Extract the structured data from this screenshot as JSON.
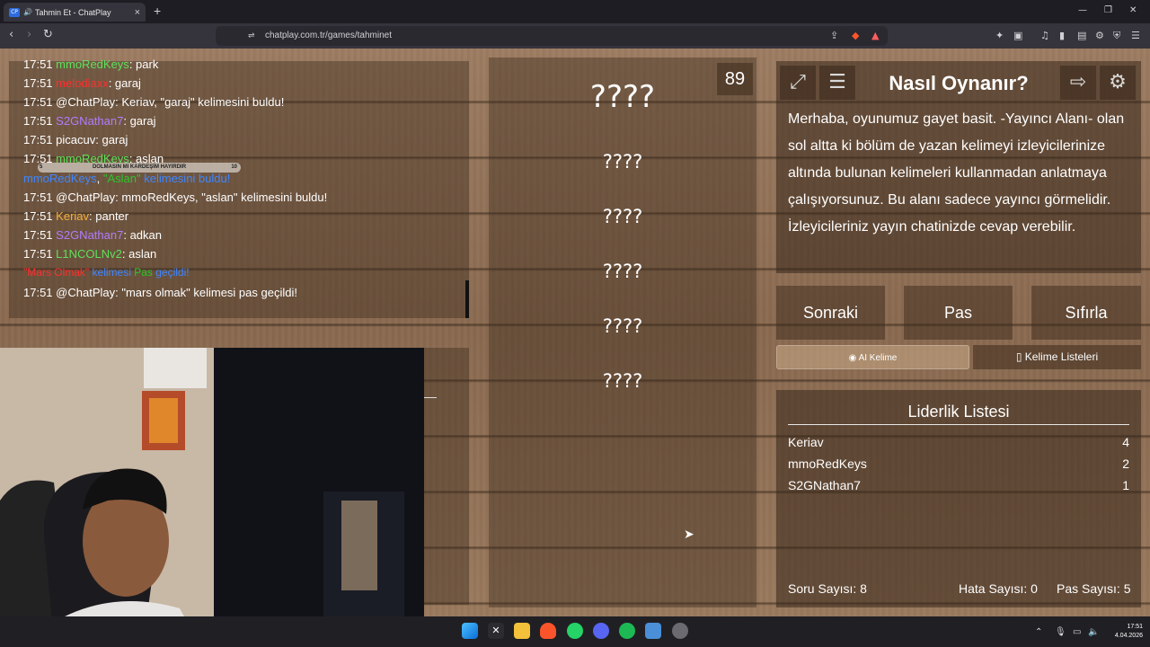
{
  "browser": {
    "tab_title": "Tahmin Et - ChatPlay",
    "tab_favicon": "CP",
    "url": "chatplay.com.tr/games/tahminet"
  },
  "chat": {
    "overlay": {
      "left": "5",
      "text": "DOLMASIN MI KARDEŞİM HAYIRDIR",
      "right": "10"
    },
    "lines": [
      {
        "time": "17:51",
        "user": "mmoRedKeys",
        "user_color": "green",
        "msg": ": park"
      },
      {
        "time": "17:51",
        "user": "melodiaxx",
        "user_color": "red",
        "msg": ": garaj"
      },
      {
        "time": "17:51",
        "user": "@ChatPlay",
        "user_color": "white",
        "msg": ": Keriav, \"garaj\" kelimesini buldu!"
      },
      {
        "time": "17:51",
        "user": "S2GNathan7",
        "user_color": "purple",
        "msg": ": garaj"
      },
      {
        "time": "17:51",
        "user": "picacuv",
        "user_color": "white",
        "msg": ": garaj"
      },
      {
        "time": "17:51",
        "user": "mmoRedKeys",
        "user_color": "green",
        "msg": ": aslan"
      }
    ],
    "system_line_1": {
      "user": "mmoRedKeys",
      "quote": "\"Aslan\"",
      "rest": " kelimesini buldu!"
    },
    "lines2": [
      {
        "time": "17:51",
        "user": "@ChatPlay",
        "user_color": "white",
        "msg": ": mmoRedKeys, \"aslan\" kelimesini buldu!"
      },
      {
        "time": "17:51",
        "user": "Keriav",
        "user_color": "orange",
        "msg": ": panter"
      },
      {
        "time": "17:51",
        "user": "S2GNathan7",
        "user_color": "purple",
        "msg": ": adkan"
      },
      {
        "time": "17:51",
        "user": "L1NCOLNv2",
        "user_color": "green",
        "msg": ": aslan"
      }
    ],
    "system_line_2": {
      "word": "\"Mars Olmak\"",
      "middle": " kelimesi ",
      "pas": "Pas",
      "rest": " geçildi!"
    },
    "last_line": {
      "time": "17:51",
      "user": "@ChatPlay",
      "msg": ": \"mars olmak\" kelimesi pas geçildi!"
    }
  },
  "game": {
    "timer": "89",
    "main_word": "????",
    "forbidden_words": [
      "????",
      "????",
      "????",
      "????",
      "????"
    ]
  },
  "howto": {
    "title": "Nasıl Oynanır?",
    "text": "Merhaba, oyunumuz gayet basit. -Yayıncı Alanı- olan sol altta ki bölüm de yazan kelimeyi izleyicilerinize altında bulunan kelimeleri kullanmadan anlatmaya çalışıyorsunuz. Bu alanı sadece yayıncı görmelidir. İzleyicileriniz yayın chatinizde cevap verebilir."
  },
  "controls": {
    "next": "Sonraki",
    "pass": "Pas",
    "reset": "Sıfırla",
    "ai_word": "AI Kelime",
    "word_lists": "Kelime Listeleri"
  },
  "leaderboard": {
    "title": "Liderlik Listesi",
    "rows": [
      {
        "name": "Keriav",
        "score": "4"
      },
      {
        "name": "mmoRedKeys",
        "score": "2"
      },
      {
        "name": "S2GNathan7",
        "score": "1"
      }
    ]
  },
  "stats": {
    "questions": "Soru Sayısı: 8",
    "errors": "Hata Sayısı: 0",
    "passes": "Pas Sayısı: 5"
  },
  "taskbar": {
    "time": "17:51",
    "date": "4.04.2026"
  },
  "colors": {
    "chat_green": "#5ee05a",
    "chat_purple": "#b07cff",
    "chat_orange": "#f5b03a",
    "chat_red": "#ff2e2e",
    "chat_blue": "#3f86ff"
  }
}
